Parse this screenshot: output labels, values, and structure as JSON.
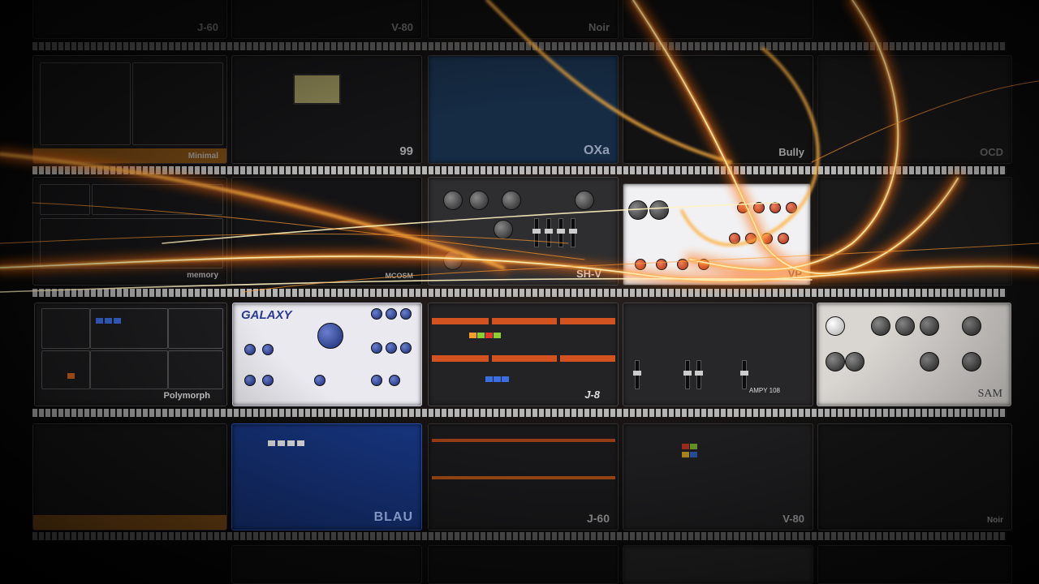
{
  "rack": {
    "row0": {
      "p1": "J-60",
      "p2": "V-80",
      "p3": "Noir"
    },
    "row1": {
      "p1": "Minimal",
      "p2": "99",
      "p3": "OXa",
      "p4": "Bully",
      "p5": "OCD"
    },
    "row2": {
      "p1": "memory",
      "p2": "MCOSM",
      "p3": "SH-V",
      "p4": "VP"
    },
    "row3": {
      "p1": "Polymorph",
      "p2": "GALAXY",
      "p3": "J-8",
      "p4": "AMPY 108",
      "p5": "SAM"
    },
    "row4": {
      "p1": "",
      "p2": "BLAU",
      "p3": "J-60",
      "p4": "V-80",
      "p5": "Noir"
    }
  },
  "colors": {
    "glow": "#ff8a1e",
    "hot": "#fff1b0",
    "galaxy_blue": "#2a3a90",
    "blau_blue": "#16337a",
    "j8_orange": "#d2531f"
  }
}
